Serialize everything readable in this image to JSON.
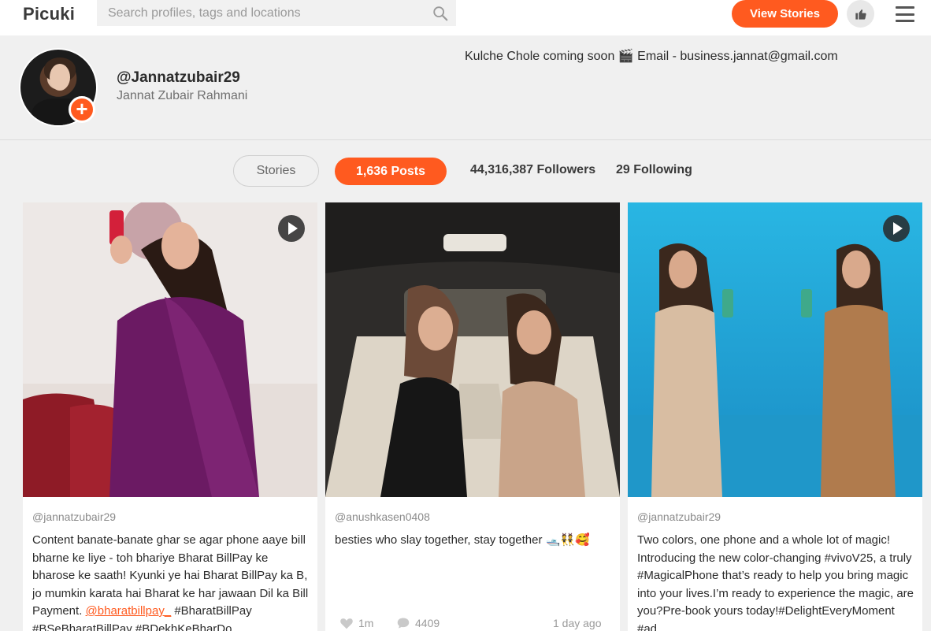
{
  "header": {
    "logo": "Picuki",
    "search_placeholder": "Search profiles, tags and locations",
    "view_stories_label": "View Stories"
  },
  "profile": {
    "username": "@Jannatzubair29",
    "full_name": "Jannat Zubair Rahmani",
    "bio": "Kulche Chole coming soon 🎬 Email - business.jannat@gmail.com"
  },
  "stats": {
    "stories_label": "Stories",
    "posts_label": "1,636 Posts",
    "followers_label": "44,316,387 Followers",
    "following_label": "29 Following"
  },
  "posts": [
    {
      "author": "@jannatzubair29",
      "caption_before": "Content banate-banate ghar se agar phone aaye bill bharne ke liye - toh bhariye Bharat BillPay ke bharose ke saath! Kyunki ye hai Bharat BillPay ka B, jo mumkin karata hai Bharat ke har jawaan Dil ka Bill Payment. ",
      "mention": "@bharatbillpay_",
      "caption_after": " #BharatBillPay #BSeBharatBillPay #BDekhKeBharDo",
      "is_video": true
    },
    {
      "author": "@anushkasen0408",
      "caption": "besties who slay together, stay together 🛥️👯🥰",
      "likes": "1m",
      "comments": "4409",
      "time": "1 day ago",
      "is_video": false
    },
    {
      "author": "@jannatzubair29",
      "caption": "Two colors, one phone and a whole lot of magic! Introducing the new color-changing #vivoV25, a truly #MagicalPhone that’s ready to help you bring magic into your lives.I’m ready to experience the magic, are you?Pre-book yours today!#DelightEveryMoment #ad",
      "is_video": true
    }
  ],
  "colors": {
    "accent": "#ff5a1f",
    "background": "#f0f0f0"
  }
}
